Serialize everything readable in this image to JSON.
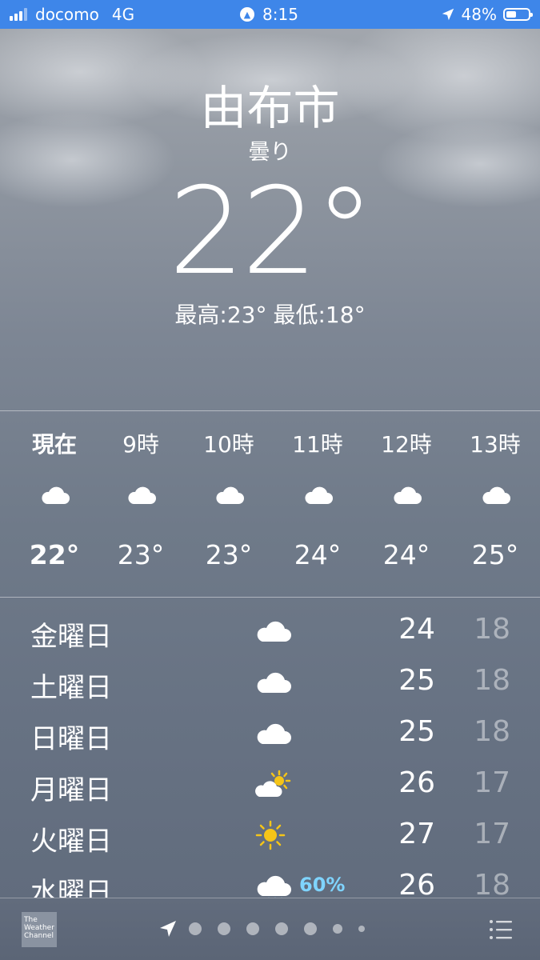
{
  "status_bar": {
    "carrier": "docomo",
    "network": "4G",
    "time": "8:15",
    "battery": "48%",
    "battery_level": 0.48
  },
  "current": {
    "city": "由布市",
    "condition": "曇り",
    "temperature": "22°",
    "high": "最高:23°",
    "low": "最低:18°"
  },
  "hourly": [
    {
      "label": "現在",
      "icon": "cloud-icon",
      "temp": "22°"
    },
    {
      "label": "9時",
      "icon": "cloud-icon",
      "temp": "23°"
    },
    {
      "label": "10時",
      "icon": "cloud-icon",
      "temp": "23°"
    },
    {
      "label": "11時",
      "icon": "cloud-icon",
      "temp": "24°"
    },
    {
      "label": "12時",
      "icon": "cloud-icon",
      "temp": "24°"
    },
    {
      "label": "13時",
      "icon": "cloud-icon",
      "temp": "25°"
    }
  ],
  "daily": [
    {
      "day": "金曜日",
      "icon": "cloud-icon",
      "pop": "",
      "high": "24",
      "low": "18"
    },
    {
      "day": "土曜日",
      "icon": "cloud-icon",
      "pop": "",
      "high": "25",
      "low": "18"
    },
    {
      "day": "日曜日",
      "icon": "cloud-icon",
      "pop": "",
      "high": "25",
      "low": "18"
    },
    {
      "day": "月曜日",
      "icon": "partly-sunny-icon",
      "pop": "",
      "high": "26",
      "low": "17"
    },
    {
      "day": "火曜日",
      "icon": "sun-icon",
      "pop": "",
      "high": "27",
      "low": "17"
    },
    {
      "day": "水曜日",
      "icon": "rain-cloud-icon",
      "pop": "60%",
      "high": "26",
      "low": "18"
    }
  ],
  "bottom_bar": {
    "logo_text": "The Weather Channel",
    "page_count": 7,
    "icons": [
      "location-arrow-icon",
      "list-icon"
    ]
  },
  "colors": {
    "status_bar": "#3e86e9",
    "precip": "#7fd4ff",
    "sun": "#f5c518"
  }
}
